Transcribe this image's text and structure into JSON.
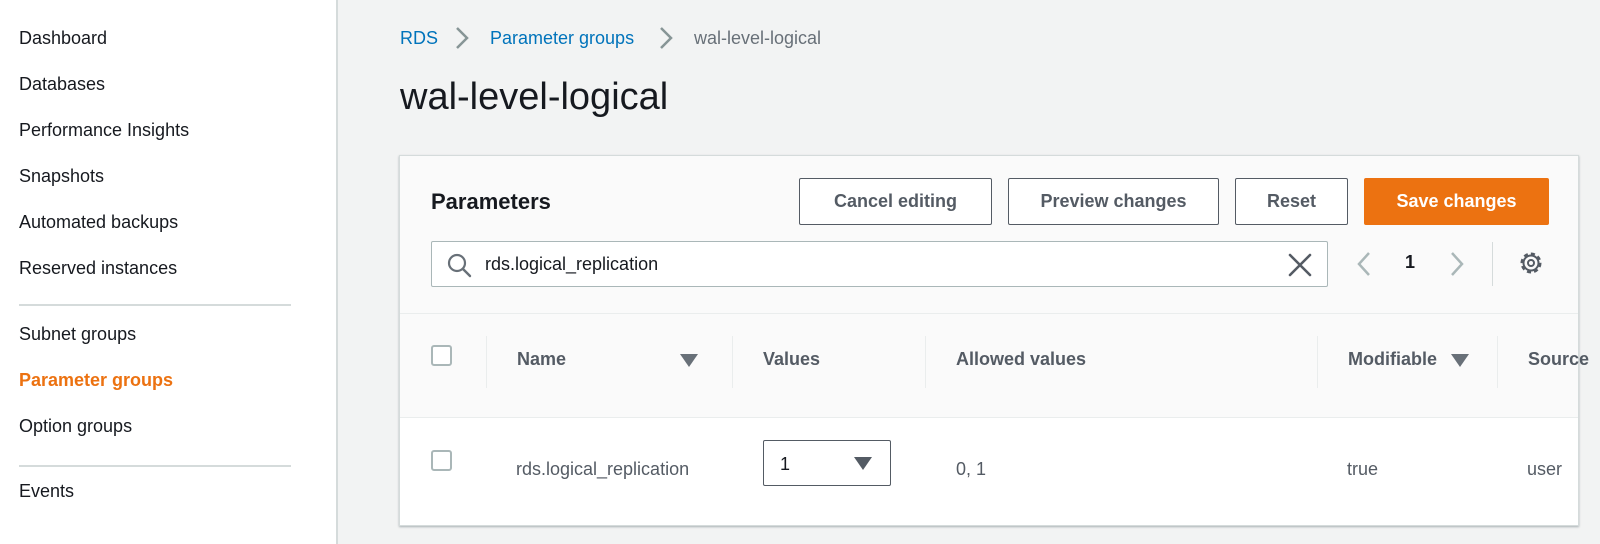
{
  "sidebar": {
    "items": [
      {
        "label": "Dashboard"
      },
      {
        "label": "Databases"
      },
      {
        "label": "Performance Insights"
      },
      {
        "label": "Snapshots"
      },
      {
        "label": "Automated backups"
      },
      {
        "label": "Reserved instances"
      },
      {
        "label": "Subnet groups"
      },
      {
        "label": "Parameter groups",
        "active": true
      },
      {
        "label": "Option groups"
      },
      {
        "label": "Events"
      }
    ]
  },
  "breadcrumb": {
    "items": [
      "RDS",
      "Parameter groups",
      "wal-level-logical"
    ]
  },
  "page": {
    "title": "wal-level-logical"
  },
  "parameters": {
    "title": "Parameters",
    "buttons": {
      "cancel": "Cancel editing",
      "preview": "Preview changes",
      "reset": "Reset",
      "save": "Save changes"
    },
    "search": {
      "value": "rds.logical_replication"
    },
    "pagination": {
      "current_page": "1"
    },
    "columns": [
      "Name",
      "Values",
      "Allowed values",
      "Modifiable",
      "Source"
    ],
    "rows": [
      {
        "name": "rds.logical_replication",
        "value": "1",
        "allowed_values": "0, 1",
        "modifiable": "true",
        "source": "user"
      }
    ]
  },
  "colors": {
    "accent": "#ec7211",
    "link": "#0073bb",
    "background": "#f2f3f3"
  }
}
